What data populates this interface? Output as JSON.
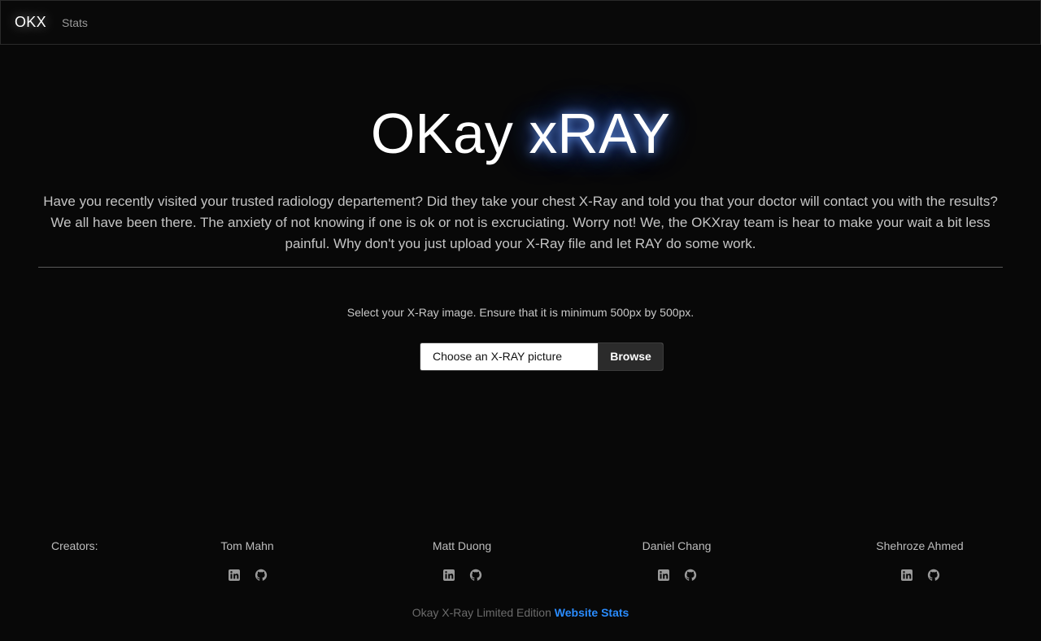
{
  "nav": {
    "brand": "OKX",
    "links": [
      "Stats"
    ]
  },
  "hero": {
    "title_part1": "OKay ",
    "title_part2": "xRAY",
    "intro": "Have you recently visited your trusted radiology departement? Did they take your chest X-Ray and told you that your doctor will contact you with the results? We all have been there. The anxiety of not knowing if one is ok or not is excruciating. Worry not! We, the OKXray team is hear to make your wait a bit less painful. Why don't you just upload your X-Ray file and let RAY do some work."
  },
  "upload": {
    "hint": "Select your X-Ray image. Ensure that it is minimum 500px by 500px.",
    "file_label": "Choose an X-RAY picture",
    "browse_label": "Browse"
  },
  "footer": {
    "label": "Creators:",
    "creators": [
      {
        "name": "Tom Mahn",
        "icons": [
          "linkedin-icon",
          "github-icon"
        ]
      },
      {
        "name": "Matt Duong",
        "icons": [
          "linkedin-icon",
          "github-icon"
        ]
      },
      {
        "name": "Daniel Chang",
        "icons": [
          "linkedin-icon",
          "github-icon"
        ]
      },
      {
        "name": "Shehroze Ahmed",
        "icons": [
          "linkedin-icon",
          "github-icon"
        ]
      }
    ],
    "note_text": "Okay X-Ray Limited Edition",
    "note_link": "Website Stats"
  },
  "colors": {
    "background": "#080808",
    "accent_link": "#2a8cff",
    "title_glow": "#4a7dff"
  }
}
